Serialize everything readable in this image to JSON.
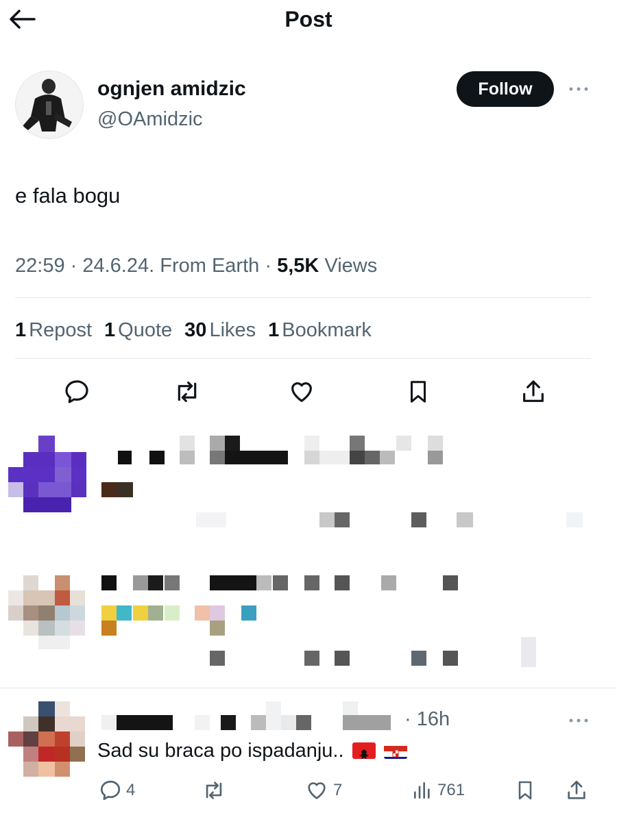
{
  "header": {
    "title": "Post"
  },
  "author": {
    "name": "ognjen amidzic",
    "handle": "@OAmidzic"
  },
  "follow_label": "Follow",
  "post": {
    "text": "e fala bogu"
  },
  "meta": {
    "time": "22:59",
    "date": "24.6.24.",
    "source": "From Earth",
    "views_count": "5,5K",
    "views_label": "Views"
  },
  "stats": [
    {
      "count": "1",
      "label": "Repost"
    },
    {
      "count": "1",
      "label": "Quote"
    },
    {
      "count": "30",
      "label": "Likes"
    },
    {
      "count": "1",
      "label": "Bookmark"
    }
  ],
  "actions": [
    "reply-icon",
    "repost-icon",
    "like-icon",
    "bookmark-icon",
    "share-icon"
  ],
  "replies": [
    {
      "blurred": true
    },
    {
      "blurred": true
    },
    {
      "time": "16h",
      "text": "Sad su braca po ispadanju..",
      "flags": [
        "albania-flag",
        "croatia-flag"
      ],
      "reply_count": "4",
      "like_count": "7",
      "view_count": "761"
    }
  ],
  "colors": {
    "text": "#0f1419",
    "secondary": "#536471",
    "divider": "#e6e9eb",
    "follow_bg": "#0f1419"
  }
}
